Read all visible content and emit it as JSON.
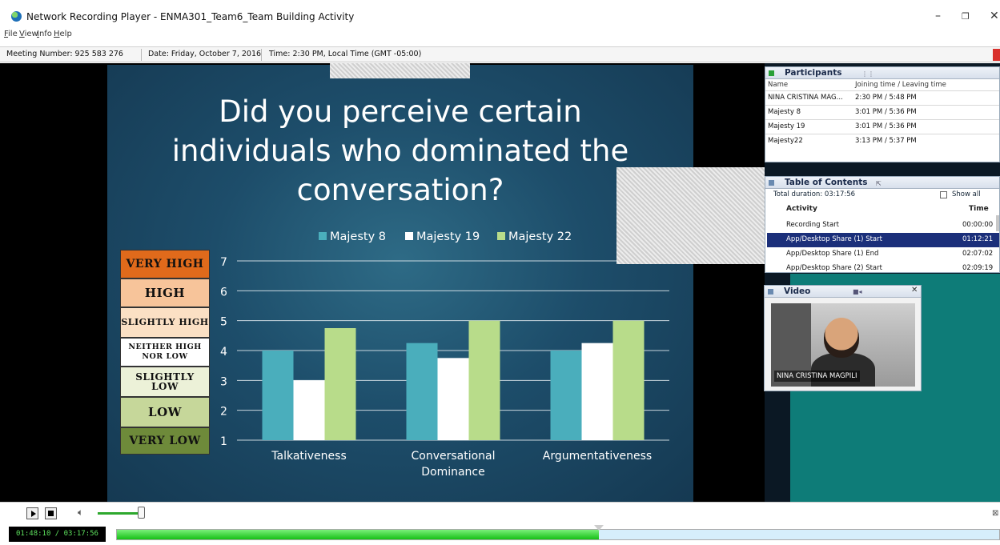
{
  "window": {
    "title": "Network Recording Player - ENMA301_Team6_Team Building Activity",
    "min_icon": "minimize-icon",
    "max_icon": "restore-icon",
    "close_icon": "close-icon",
    "min_glyph": "–",
    "max_glyph": "❐",
    "close_glyph": "✕"
  },
  "menu": [
    {
      "label": "File",
      "u": "F",
      "rest": "ile"
    },
    {
      "label": "View",
      "u": "V",
      "rest": "iew"
    },
    {
      "label": "Info",
      "u": "I",
      "rest": "nfo"
    },
    {
      "label": "Help",
      "u": "H",
      "rest": "elp"
    }
  ],
  "infobar": {
    "meeting": "Meeting Number: 925 583 276",
    "date": "Date: Friday, October 7, 2016",
    "time": "Time: 2:30 PM, Local Time (GMT -05:00)"
  },
  "slide": {
    "question_lines": [
      "Did you perceive certain",
      "individuals who dominated the",
      "conversation?"
    ],
    "scale": [
      {
        "label": "VERY HIGH",
        "color": "#e06a1b"
      },
      {
        "label": "HIGH",
        "color": "#f7c49a"
      },
      {
        "label": "SLIGHTLY HIGH",
        "color": "#fbe0c4"
      },
      {
        "label": "NEITHER HIGH NOR LOW",
        "color": "#ffffff"
      },
      {
        "label": "SLIGHTLY LOW",
        "color": "#ecf1d8"
      },
      {
        "label": "LOW",
        "color": "#c6d79a"
      },
      {
        "label": "VERY LOW",
        "color": "#6e8a3a"
      }
    ]
  },
  "chart_data": {
    "type": "bar",
    "categories": [
      "Talkativeness",
      "Conversational Dominance",
      "Argumentativeness"
    ],
    "series": [
      {
        "name": "Majesty 8",
        "values": [
          4.0,
          4.25,
          4.0
        ],
        "color": "#4aaebc"
      },
      {
        "name": "Majesty 19",
        "values": [
          3.0,
          3.75,
          4.25
        ],
        "color": "#ffffff"
      },
      {
        "name": "Majesty 22",
        "values": [
          4.75,
          5.0,
          5.0
        ],
        "color": "#b8dc8a"
      }
    ],
    "ylim": [
      1,
      7
    ],
    "yticks": [
      1,
      2,
      3,
      4,
      5,
      6,
      7
    ],
    "grid": true,
    "legend": "top"
  },
  "participants": {
    "title": "Participants",
    "col_name": "Name",
    "col_time": "Joining time / Leaving time",
    "rows": [
      {
        "name": "NINA CRISTINA MAG...",
        "time": "2:30 PM / 5:48 PM"
      },
      {
        "name": "Majesty 8",
        "time": "3:01 PM / 5:36 PM"
      },
      {
        "name": "Majesty 19",
        "time": "3:01 PM / 5:36 PM"
      },
      {
        "name": "Majesty22",
        "time": "3:13 PM / 5:37 PM"
      }
    ]
  },
  "toc": {
    "title": "Table of Contents",
    "total": "Total duration: 03:17:56",
    "show_all": "Show all",
    "col_activity": "Activity",
    "col_time": "Time",
    "rows": [
      {
        "activity": "Recording Start",
        "time": "00:00:00",
        "selected": false
      },
      {
        "activity": "App/Desktop Share (1) Start",
        "time": "01:12:21",
        "selected": true
      },
      {
        "activity": "App/Desktop Share (1) End",
        "time": "02:07:02",
        "selected": false
      },
      {
        "activity": "App/Desktop Share (2) Start",
        "time": "02:09:19",
        "selected": false
      }
    ]
  },
  "video": {
    "title": "Video",
    "name": "NINA CRISTINA MAGPILI"
  },
  "playback": {
    "time": "01:48:10 / 03:17:56",
    "progress": 0.5467,
    "volume": 0.9
  }
}
